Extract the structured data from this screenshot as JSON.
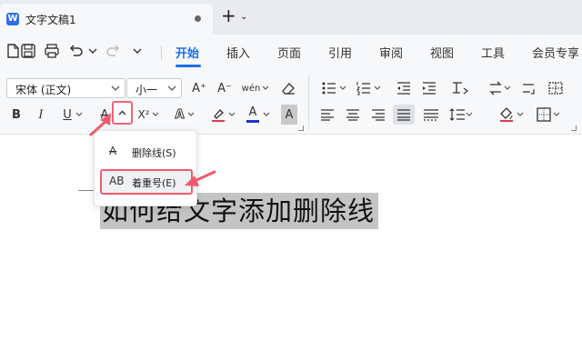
{
  "window": {
    "doc_tab_title": "文字文稿1",
    "app_badge": "W",
    "new_tab_symbol": "+",
    "new_tab_chevron": "⌄"
  },
  "menu": {
    "items": [
      {
        "label": "开始",
        "active": true
      },
      {
        "label": "插入"
      },
      {
        "label": "页面"
      },
      {
        "label": "引用"
      },
      {
        "label": "审阅"
      },
      {
        "label": "视图"
      },
      {
        "label": "工具"
      },
      {
        "label": "会员专享"
      }
    ],
    "accent_color": "#1f6ee6"
  },
  "ribbon": {
    "font_name": "宋体 (正文)",
    "font_size": "小一",
    "bold": "B",
    "italic": "I",
    "underline": "U",
    "strikethrough": "A",
    "superscript": "X²",
    "highlight_letter": "A",
    "font_color_letter": "A",
    "char_shading_letter": "A",
    "grow_font": "A⁺",
    "shrink_font": "A⁻",
    "pinyin": "wén",
    "font_color_swatch": "#1a35d1",
    "highlight_swatch": "#e63946"
  },
  "dropdown": {
    "items": [
      {
        "icon": "A",
        "label": "删除线(S)"
      },
      {
        "icon": "AB",
        "label": "着重号(E)"
      }
    ]
  },
  "document": {
    "selected_text": "如何给文字添加删除线"
  },
  "annotation_color": "#ef5b6c"
}
